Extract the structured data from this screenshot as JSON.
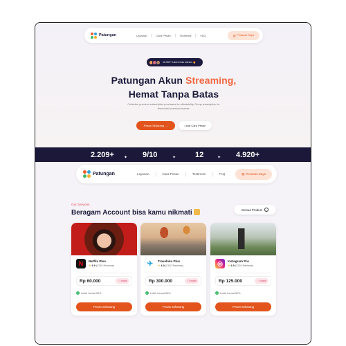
{
  "brand": {
    "name": "Patungan"
  },
  "nav": {
    "links": [
      "Layanan",
      "Cara Pesan",
      "Testimoni",
      "FAQ"
    ],
    "cta": "Pesanan Saya"
  },
  "hero": {
    "badge": "10.000+ Users Has Joined 🔥",
    "title_line1_prefix": "Patungan Akun ",
    "title_line1_accent": "Streaming,",
    "title_line2": "Hemat Tanpa Batas",
    "description": "Collective premium subscription purchases for affordability. Group subscription for discounted premium access.",
    "primary_button": "Pesan Sekarang →",
    "secondary_button": "Lihat Cara Pesan"
  },
  "stats": [
    "2.209+",
    "9/10",
    "12",
    "4.920+"
  ],
  "services": {
    "eyebrow": "Our Services",
    "title": "Beragam Account bisa kamu nikmati",
    "all_button": "Semua Product",
    "cards": [
      {
        "name": "Netflix Plus",
        "rating": "4.9",
        "reviews": "(2120 Reviews)",
        "price": "Rp 60.000",
        "duration": "1 month",
        "saving": "Lebih hemat 50%",
        "order": "Pesan Sekarang",
        "icon": "netflix-icon",
        "icon_color": "#e50914"
      },
      {
        "name": "Traveloka Plus",
        "rating": "4.9",
        "reviews": "(2120 Reviews)",
        "price": "Rp 300.000",
        "duration": "1 month",
        "saving": "Lebih hemat 50%",
        "order": "Pesan Sekarang",
        "icon": "traveloka-icon",
        "icon_color": "#1ba0e2"
      },
      {
        "name": "Instagram Pro",
        "rating": "4.9",
        "reviews": "(2120 Reviews)",
        "price": "Rp 125.000",
        "duration": "1 month",
        "saving": "Lebih hemat 50%",
        "order": "Pesan Sekarang",
        "icon": "instagram-icon",
        "icon_color": "#d6249f"
      }
    ]
  },
  "colors": {
    "accent": "#e2541c",
    "headline_accent": "#f26640",
    "dark": "#1b1839"
  }
}
